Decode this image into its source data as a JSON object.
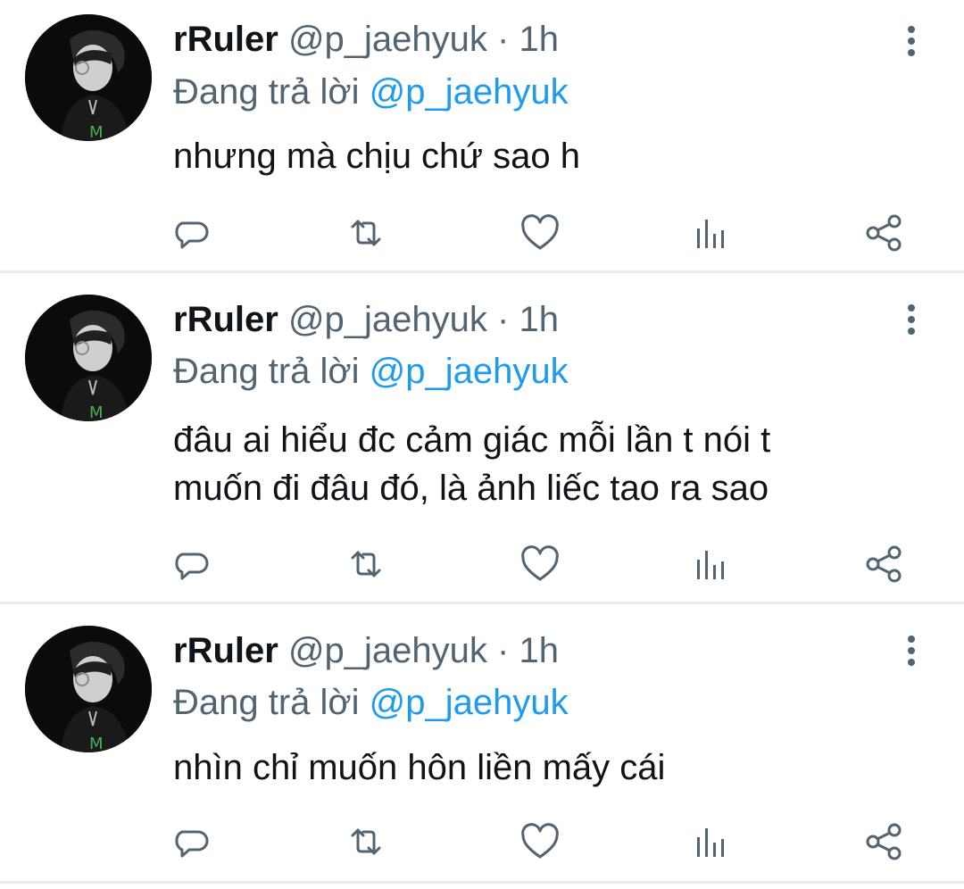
{
  "colors": {
    "text_primary": "#0f1419",
    "text_secondary": "#536471",
    "mention": "#1d9bf0",
    "divider": "#e6ecf0",
    "icon": "#536471"
  },
  "icons": {
    "reply": "reply-icon",
    "retweet": "retweet-icon",
    "like": "heart-icon",
    "stats": "analytics-icon",
    "share": "share-icon",
    "more": "more-vertical-icon"
  },
  "tweets": [
    {
      "display_name": "rRuler",
      "handle": "@p_jaehyuk",
      "separator": "·",
      "time": "1h",
      "replying_prefix": "Đang trả lời",
      "replying_to": "@p_jaehyuk",
      "text": "nhưng mà chịu chứ sao h"
    },
    {
      "display_name": "rRuler",
      "handle": "@p_jaehyuk",
      "separator": "·",
      "time": "1h",
      "replying_prefix": "Đang trả lời",
      "replying_to": "@p_jaehyuk",
      "text": "đâu ai hiểu đc cảm giác mỗi lần t nói t\nmuốn đi đâu đó, là ảnh liếc tao ra sao"
    },
    {
      "display_name": "rRuler",
      "handle": "@p_jaehyuk",
      "separator": "·",
      "time": "1h",
      "replying_prefix": "Đang trả lời",
      "replying_to": "@p_jaehyuk",
      "text": "nhìn chỉ muốn hôn liền mấy cái"
    }
  ]
}
